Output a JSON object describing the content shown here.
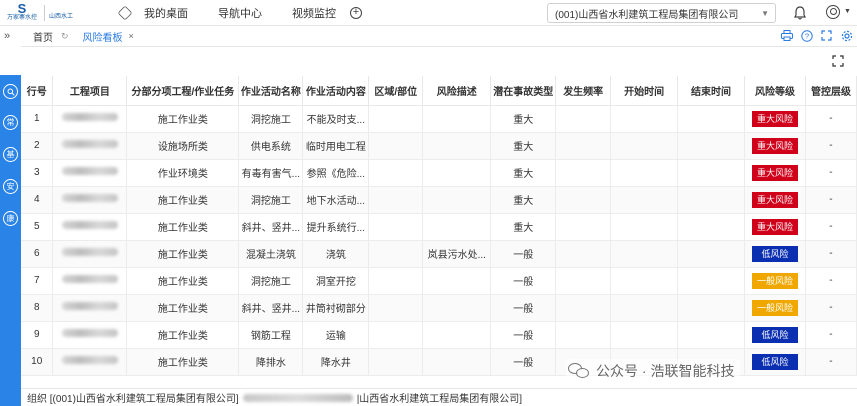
{
  "header": {
    "logo_text_1": "万家寨水控",
    "logo_text_2": "山西水工",
    "nav": [
      "我的桌面",
      "导航中心",
      "视频监控"
    ],
    "org_select": "(001)山西省水利建筑工程局集团有限公司"
  },
  "sidebar": {
    "toggle": "»",
    "buttons": [
      "常",
      "基",
      "安",
      "康"
    ]
  },
  "tabs": {
    "home": "首页",
    "active": "风险看板",
    "close": "×"
  },
  "table": {
    "headers": [
      "行号",
      "工程项目",
      "分部分项工程/作业任务",
      "作业活动名称",
      "作业活动内容",
      "区域/部位",
      "风险描述",
      "潜在事故类型",
      "发生频率",
      "开始时间",
      "结束时间",
      "风险等级",
      "管控层级"
    ],
    "rows": [
      {
        "no": "1",
        "task": "施工作业类",
        "activity": "洞挖施工",
        "content": "不能及时支...",
        "area": "",
        "desc": "",
        "accident": "重大",
        "risk": "重大风险",
        "risk_color": "#d0001b",
        "level": "-"
      },
      {
        "no": "2",
        "task": "设施场所类",
        "activity": "供电系统",
        "content": "临时用电工程",
        "area": "",
        "desc": "",
        "accident": "重大",
        "risk": "重大风险",
        "risk_color": "#d0001b",
        "level": "-"
      },
      {
        "no": "3",
        "task": "作业环境类",
        "activity": "有毒有害气...",
        "content": "参照《危险...",
        "area": "",
        "desc": "",
        "accident": "重大",
        "risk": "重大风险",
        "risk_color": "#d0001b",
        "level": "-"
      },
      {
        "no": "4",
        "task": "施工作业类",
        "activity": "洞挖施工",
        "content": "地下水活动...",
        "area": "",
        "desc": "",
        "accident": "重大",
        "risk": "重大风险",
        "risk_color": "#d0001b",
        "level": "-"
      },
      {
        "no": "5",
        "task": "施工作业类",
        "activity": "斜井、竖井...",
        "content": "提升系统行...",
        "area": "",
        "desc": "",
        "accident": "重大",
        "risk": "重大风险",
        "risk_color": "#d0001b",
        "level": "-"
      },
      {
        "no": "6",
        "task": "施工作业类",
        "activity": "混凝土浇筑",
        "content": "浇筑",
        "area": "",
        "desc": "岚县污水处...",
        "accident": "一般",
        "risk": "低风险",
        "risk_color": "#0b2fb1",
        "level": "-"
      },
      {
        "no": "7",
        "task": "施工作业类",
        "activity": "洞挖施工",
        "content": "洞室开挖",
        "area": "",
        "desc": "",
        "accident": "一般",
        "risk": "一般风险",
        "risk_color": "#f0a800",
        "level": "-"
      },
      {
        "no": "8",
        "task": "施工作业类",
        "activity": "斜井、竖井...",
        "content": "井筒衬砌部分",
        "area": "",
        "desc": "",
        "accident": "一般",
        "risk": "一般风险",
        "risk_color": "#f0a800",
        "level": "-"
      },
      {
        "no": "9",
        "task": "施工作业类",
        "activity": "钢筋工程",
        "content": "运输",
        "area": "",
        "desc": "",
        "accident": "一般",
        "risk": "低风险",
        "risk_color": "#0b2fb1",
        "level": "-"
      },
      {
        "no": "10",
        "task": "施工作业类",
        "activity": "降排水",
        "content": "降水井",
        "area": "",
        "desc": "",
        "accident": "一般",
        "risk": "低风险",
        "risk_color": "#0b2fb1",
        "level": "-"
      }
    ]
  },
  "footer": {
    "prefix": "组织 [(001)山西省水利建筑工程局集团有限公司]",
    "suffix": "|山西省水利建筑工程局集团有限公司]"
  },
  "watermark": {
    "text": "公众号 · 浩联智能科技"
  },
  "colors": {
    "accent": "#2a84e8",
    "major_risk": "#d0001b",
    "low_risk": "#0b2fb1",
    "general_risk": "#f0a800"
  }
}
